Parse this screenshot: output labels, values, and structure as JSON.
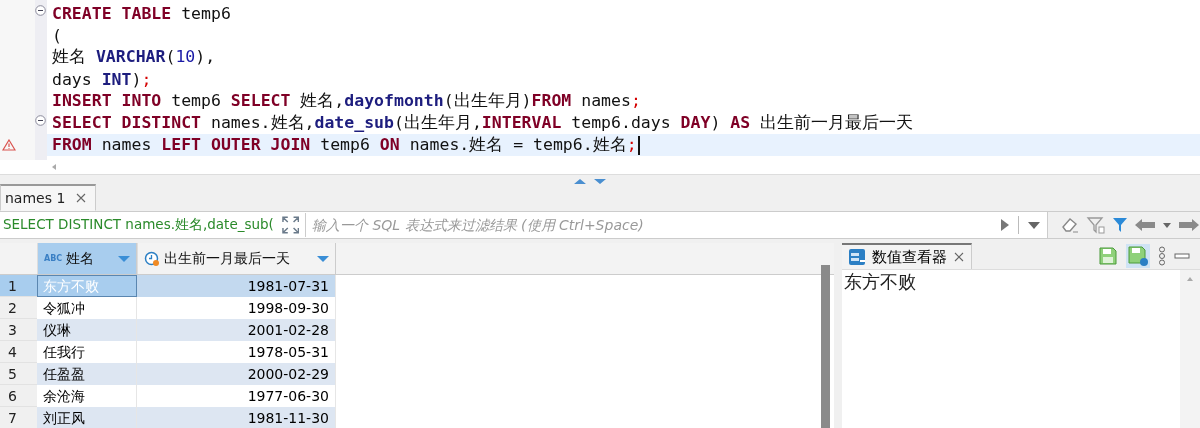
{
  "editor": {
    "lines": [
      {
        "fold": true,
        "warning": false,
        "current": false,
        "tokens": [
          {
            "kind": "keyword",
            "text": "CREATE TABLE"
          },
          {
            "kind": "plain",
            "text": " temp6"
          }
        ]
      },
      {
        "fold": false,
        "warning": false,
        "current": false,
        "tokens": [
          {
            "kind": "plain",
            "text": "("
          }
        ]
      },
      {
        "fold": false,
        "warning": false,
        "current": false,
        "tokens": [
          {
            "kind": "plain",
            "text": "姓名 "
          },
          {
            "kind": "type",
            "text": "VARCHAR"
          },
          {
            "kind": "plain",
            "text": "("
          },
          {
            "kind": "number",
            "text": "10"
          },
          {
            "kind": "plain",
            "text": "),"
          }
        ]
      },
      {
        "fold": false,
        "warning": false,
        "current": false,
        "tokens": [
          {
            "kind": "plain",
            "text": "days "
          },
          {
            "kind": "type",
            "text": "INT"
          },
          {
            "kind": "plain",
            "text": ")"
          },
          {
            "kind": "delimiter",
            "text": ";"
          }
        ]
      },
      {
        "fold": false,
        "warning": false,
        "current": false,
        "tokens": [
          {
            "kind": "keyword",
            "text": "INSERT INTO"
          },
          {
            "kind": "plain",
            "text": " temp6 "
          },
          {
            "kind": "keyword",
            "text": "SELECT"
          },
          {
            "kind": "plain",
            "text": " 姓名,"
          },
          {
            "kind": "type",
            "text": "dayofmonth"
          },
          {
            "kind": "plain",
            "text": "(出生年月)"
          },
          {
            "kind": "keyword",
            "text": "FROM"
          },
          {
            "kind": "plain",
            "text": " names"
          },
          {
            "kind": "delimiter",
            "text": ";"
          }
        ]
      },
      {
        "fold": true,
        "warning": false,
        "current": false,
        "tokens": [
          {
            "kind": "keyword",
            "text": "SELECT DISTINCT"
          },
          {
            "kind": "plain",
            "text": " names.姓名,"
          },
          {
            "kind": "type",
            "text": "date_sub"
          },
          {
            "kind": "plain",
            "text": "(出生年月,"
          },
          {
            "kind": "keyword",
            "text": "INTERVAL"
          },
          {
            "kind": "plain",
            "text": " temp6.days "
          },
          {
            "kind": "keyword",
            "text": "DAY"
          },
          {
            "kind": "plain",
            "text": ") "
          },
          {
            "kind": "keyword",
            "text": "AS"
          },
          {
            "kind": "plain",
            "text": " 出生前一月最后一天"
          }
        ]
      },
      {
        "fold": false,
        "warning": true,
        "current": true,
        "tokens": [
          {
            "kind": "keyword",
            "text": "FROM"
          },
          {
            "kind": "plain",
            "text": " names "
          },
          {
            "kind": "keyword",
            "text": "LEFT OUTER JOIN"
          },
          {
            "kind": "plain",
            "text": " temp6 "
          },
          {
            "kind": "keyword",
            "text": "ON"
          },
          {
            "kind": "plain",
            "text": " names.姓名 = temp6.姓名"
          },
          {
            "kind": "delimiter",
            "text": ";"
          }
        ]
      }
    ]
  },
  "results_tab": {
    "label": "names 1",
    "selected": true
  },
  "filter_bar": {
    "query": "SELECT DISTINCT names.姓名,date_sub(",
    "placeholder": "输入一个 SQL 表达式来过滤结果 (使用 Ctrl+Space)"
  },
  "table": {
    "columns": [
      {
        "kind": "text",
        "badge": "ABC",
        "label": "姓名",
        "selected": true
      },
      {
        "kind": "date",
        "label": "出生前一月最后一天",
        "selected": false
      }
    ],
    "rows": [
      {
        "number": "1",
        "cells": [
          "东方不败",
          "1981-07-31"
        ],
        "selected": true
      },
      {
        "number": "2",
        "cells": [
          "令狐冲",
          "1998-09-30"
        ],
        "selected": false
      },
      {
        "number": "3",
        "cells": [
          "仪琳",
          "2001-02-28"
        ],
        "selected": false
      },
      {
        "number": "4",
        "cells": [
          "任我行",
          "1978-05-31"
        ],
        "selected": false
      },
      {
        "number": "5",
        "cells": [
          "任盈盈",
          "2000-02-29"
        ],
        "selected": false
      },
      {
        "number": "6",
        "cells": [
          "余沧海",
          "1977-06-30"
        ],
        "selected": false
      },
      {
        "number": "7",
        "cells": [
          "刘正风",
          "1981-11-30"
        ],
        "selected": false
      }
    ]
  },
  "value_viewer": {
    "title": "数值查看器",
    "value": "东方不败"
  }
}
